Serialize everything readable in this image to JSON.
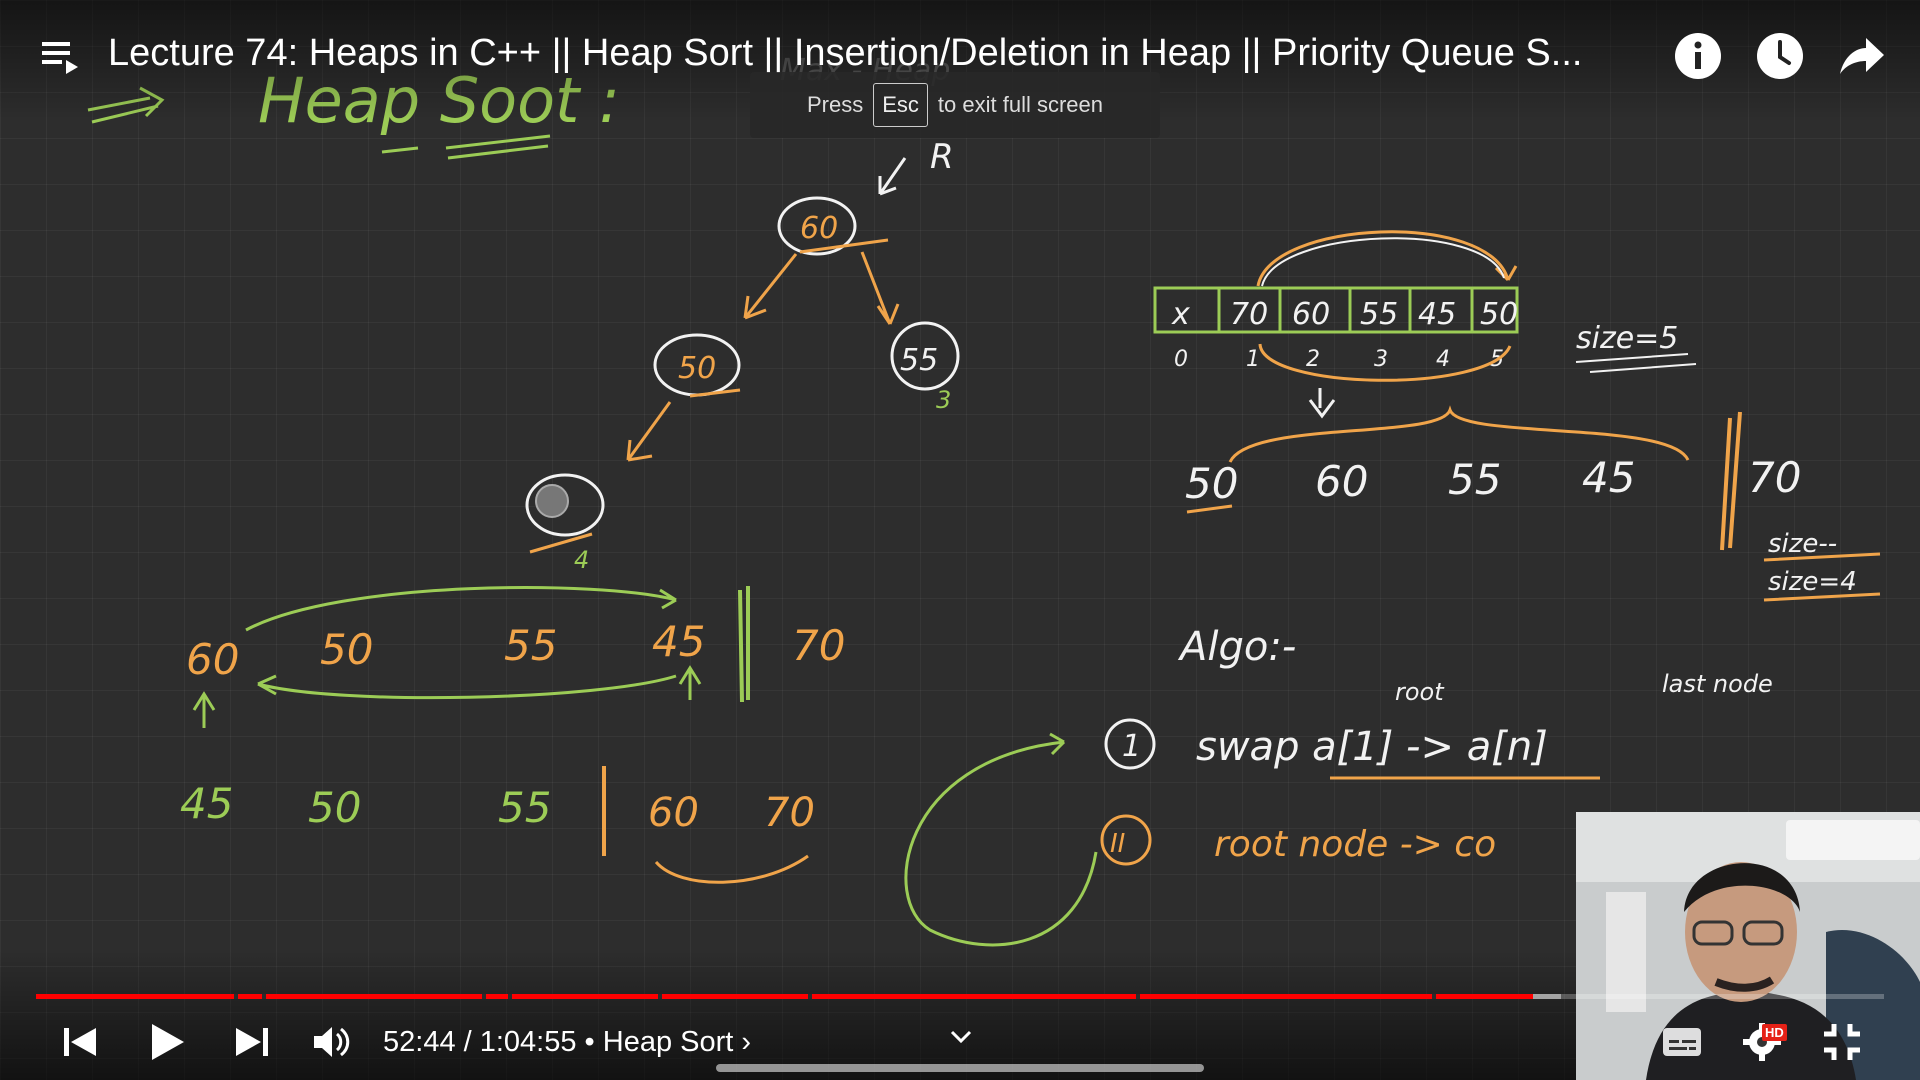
{
  "video": {
    "title": "Lecture 74: Heaps in C++ || Heap Sort || Insertion/Deletion in Heap || Priority Queue S...",
    "time_current": "52:44",
    "time_total": "1:04:55",
    "chapter": "Heap Sort",
    "time_display": "52:44 / 1:04:55 • Heap Sort ›",
    "progress_played": 0.81,
    "progress_loaded": 0.825,
    "hd_badge": "HD"
  },
  "fullscreen_hint": {
    "press": "Press",
    "key": "Esc",
    "rest": "to exit full screen"
  },
  "icons": {
    "playlist": "playlist-icon",
    "info": "info-icon",
    "watch_later": "clock-icon",
    "share": "share-icon",
    "prev": "previous-icon",
    "play": "play-icon",
    "next": "next-icon",
    "volume": "volume-icon",
    "captions": "captions-icon",
    "settings": "gear-icon",
    "exit_fullscreen": "exit-fullscreen-icon"
  },
  "board": {
    "heading": "Heap Soot :",
    "faded_note": "Max - Heap",
    "tree": {
      "root": "60",
      "left": "50",
      "right": "55",
      "leaf_index": "4",
      "right_index": "3",
      "pointer": "R"
    },
    "array": {
      "cells": [
        "x",
        "70",
        "60",
        "55",
        "45",
        "50"
      ],
      "indices": [
        "0",
        "1",
        "2",
        "3",
        "4",
        "5"
      ],
      "size_note": "size=5"
    },
    "seq1": {
      "items": [
        "50",
        "60",
        "55",
        "45"
      ],
      "sorted": "70",
      "notes": [
        "size--",
        "size=4"
      ]
    },
    "seq2": {
      "items": [
        "60",
        "50",
        "55",
        "45"
      ],
      "sorted": "70"
    },
    "seq3": {
      "items": [
        "45",
        "50",
        "55"
      ],
      "sorted": [
        "60",
        "70"
      ]
    },
    "algo": {
      "heading": "Algo:-",
      "step1_num": "1",
      "step1": "swap a[1] -> a[n]",
      "step1_notes": [
        "root",
        "last node"
      ],
      "step2_num": "II",
      "step2": "root node -> co"
    }
  },
  "colors": {
    "progress": "#ff0000",
    "chalk_orange": "#f0a44a",
    "chalk_green": "#9ccc56",
    "chalk_white": "#f2f2f2"
  }
}
